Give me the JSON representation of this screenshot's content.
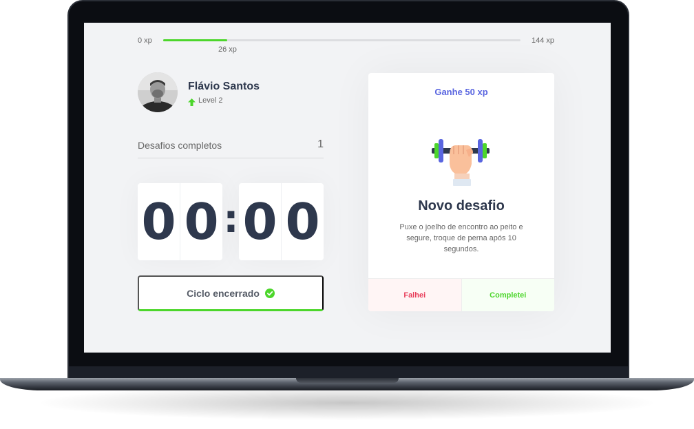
{
  "experience": {
    "min_label": "0 xp",
    "max_label": "144 xp",
    "current_label": "26 xp",
    "progress_percent": 18
  },
  "profile": {
    "name": "Flávio Santos",
    "level_label": "Level 2"
  },
  "challenges_completed": {
    "label": "Desafios completos",
    "count": "1"
  },
  "countdown": {
    "minute_left": "0",
    "minute_right": "0",
    "separator": ":",
    "second_left": "0",
    "second_right": "0"
  },
  "cycle_button": {
    "label": "Ciclo encerrado"
  },
  "challenge_card": {
    "reward_label": "Ganhe 50 xp",
    "title": "Novo desafio",
    "description": "Puxe o joelho de encontro ao peito e segure, troque de perna após 10 segundos.",
    "failed_label": "Falhei",
    "completed_label": "Completei"
  },
  "icons": {
    "level": "arrow-up-icon",
    "cycle_status": "check-circle-icon",
    "challenge": "dumbbell-icon"
  },
  "colors": {
    "accent_green": "#4cd62b",
    "accent_blue": "#5965e0",
    "danger_red": "#e83f5b",
    "text_title": "#2e384d",
    "text_body": "#666666",
    "background": "#f2f3f5"
  }
}
